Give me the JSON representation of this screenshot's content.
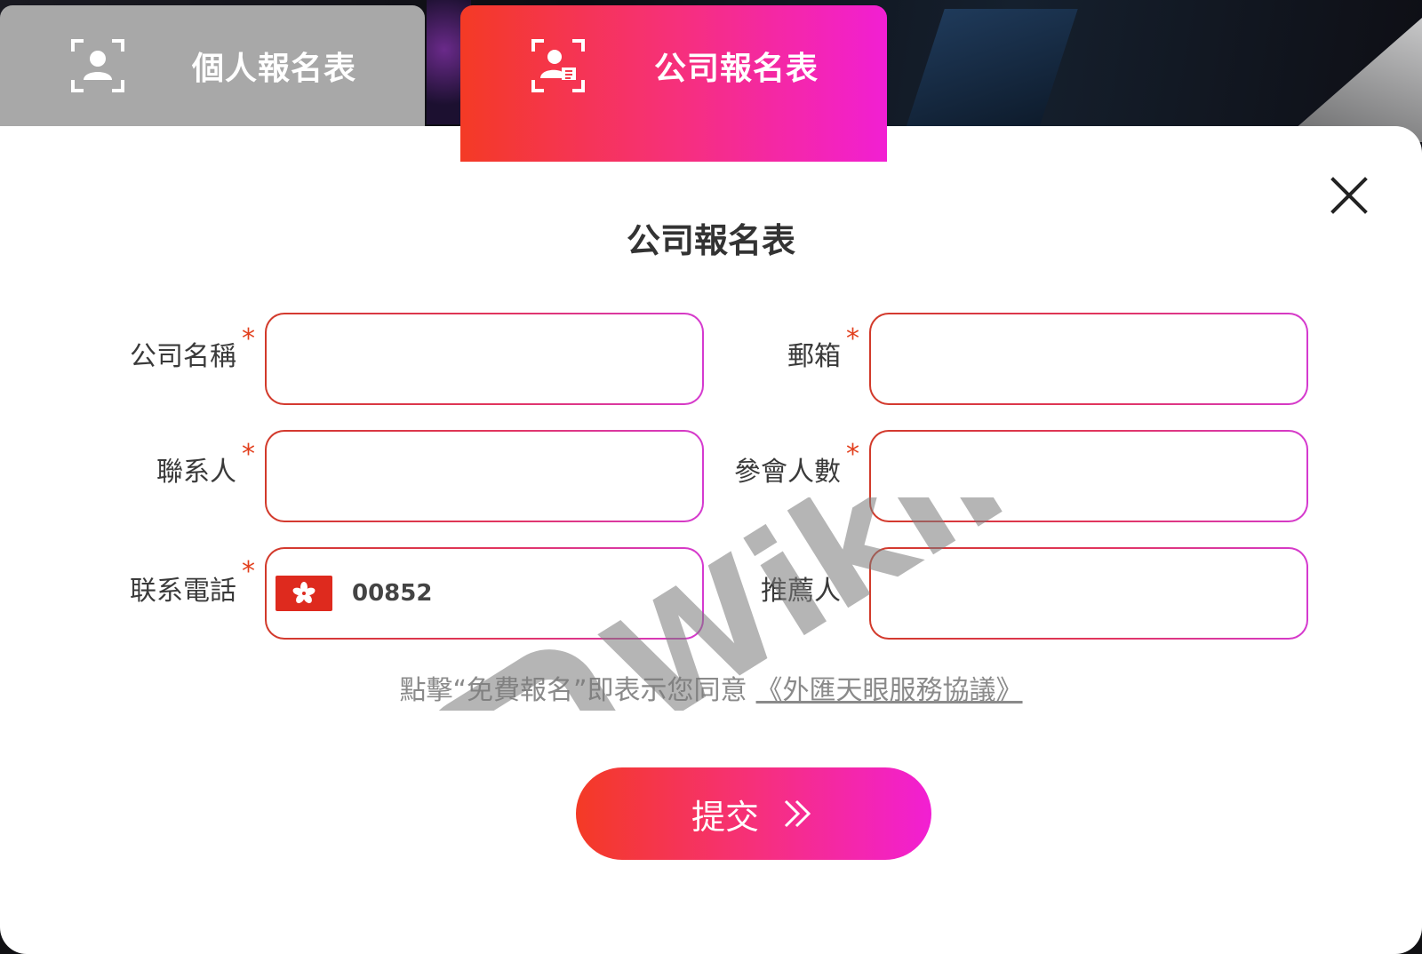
{
  "tabs": [
    {
      "label": "個人報名表",
      "icon": "person-scan-icon",
      "active": false
    },
    {
      "label": "公司報名表",
      "icon": "business-person-scan-icon",
      "active": true
    }
  ],
  "modal": {
    "title": "公司報名表",
    "close_icon": "close-icon"
  },
  "fields": {
    "company_name": {
      "label": "公司名稱",
      "required_mark": "*",
      "value": ""
    },
    "email": {
      "label": "郵箱",
      "required_mark": "*",
      "value": ""
    },
    "contact": {
      "label": "聯系人",
      "required_mark": "*",
      "value": ""
    },
    "attendees": {
      "label": "參會人數",
      "required_mark": "*",
      "value": ""
    },
    "phone": {
      "label": "联系電話",
      "required_mark": "*",
      "flag": "hong-kong-flag",
      "dial_code": "00852",
      "value": ""
    },
    "referrer": {
      "label": "推薦人",
      "value": ""
    }
  },
  "agreement": {
    "text": "點擊“免費報名”即表示您同意",
    "link": "《外匯天眼服務協議》"
  },
  "submit": {
    "label": "提交",
    "icon": "double-chevron-right-icon"
  },
  "watermark": {
    "text": "WikiFX"
  },
  "colors": {
    "accent_start": "#f43a25",
    "accent_end": "#f21fd3",
    "inactive_tab": "#a8a8a8",
    "required": "#e2401e"
  }
}
